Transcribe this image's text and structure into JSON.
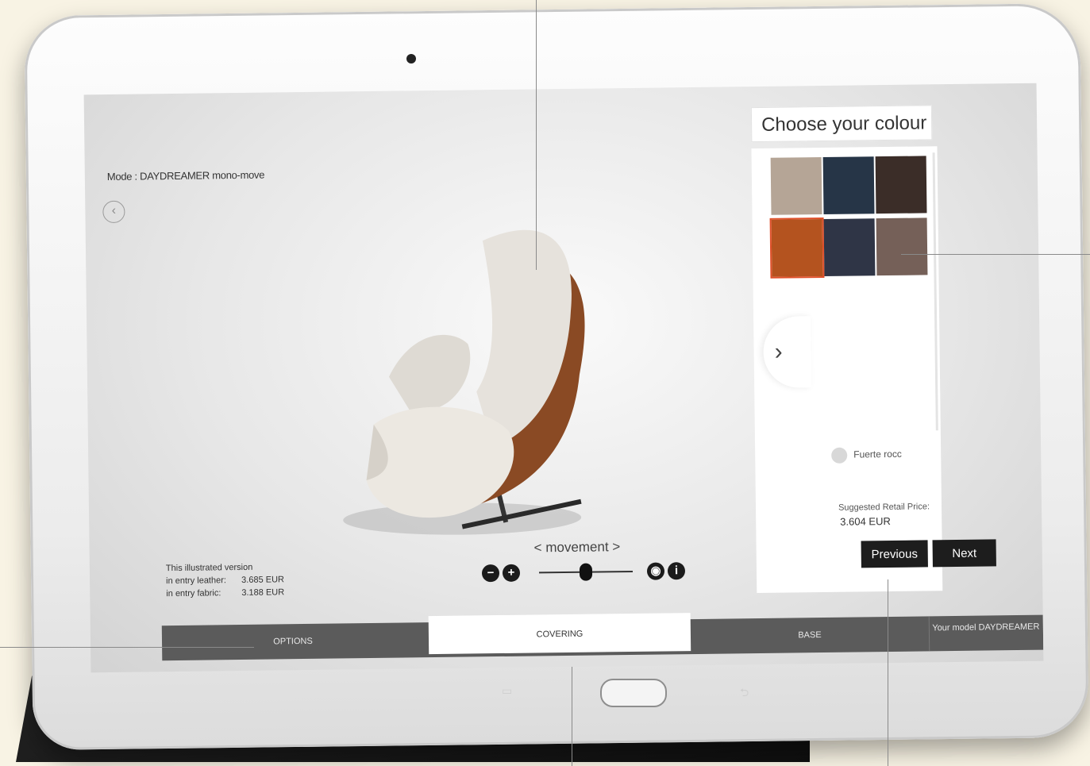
{
  "screen": {
    "model_label": "Mode : DAYDREAMER mono-move",
    "back_icon": "chevron-left-icon"
  },
  "illustrated_price": {
    "heading": "This illustrated version",
    "rows": [
      {
        "label": "in entry leather:",
        "value": "3.685 EUR"
      },
      {
        "label": "in entry fabric:",
        "value": "3.188 EUR"
      }
    ]
  },
  "movement": {
    "label": "< movement >",
    "zoom_out": "−",
    "zoom_in": "+",
    "slider_position": 0.5
  },
  "colour_panel": {
    "title": "Choose your colour",
    "swatches": [
      {
        "name": "taupe",
        "color": "#b5a596"
      },
      {
        "name": "navy",
        "color": "#263547"
      },
      {
        "name": "dark-brown",
        "color": "#3b2d28"
      },
      {
        "name": "cognac",
        "color": "#b4531f",
        "selected": true
      },
      {
        "name": "charcoal-blue",
        "color": "#2f3546"
      },
      {
        "name": "mocha",
        "color": "#756058"
      }
    ],
    "selected_name": "Fuerte rocc",
    "srp_label": "Suggested Retail Price:",
    "srp_value": "3.604 EUR",
    "previous_label": "Previous",
    "next_label": "Next"
  },
  "nav": {
    "tabs": [
      "OPTIONS",
      "COVERING",
      "BASE",
      "Your model DAYDREAMER"
    ],
    "active": "COVERING"
  },
  "device": {
    "soft_keys": [
      "▭",
      "⮌"
    ]
  }
}
